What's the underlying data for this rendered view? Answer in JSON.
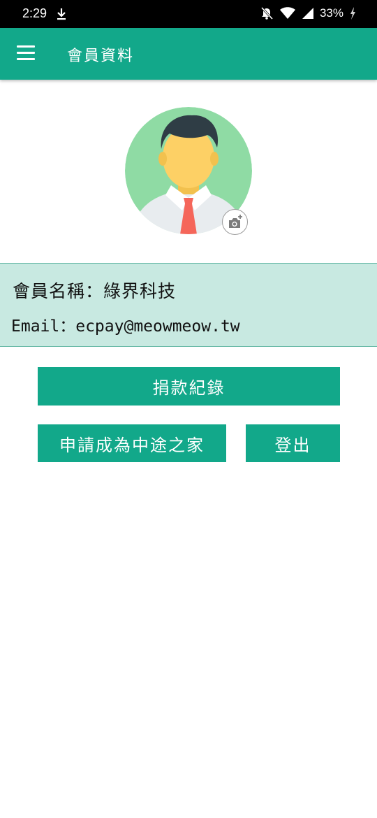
{
  "status_bar": {
    "time": "2:29",
    "battery": "33%"
  },
  "app_bar": {
    "title": "會員資料"
  },
  "profile": {
    "name_line": "會員名稱：綠界科技",
    "email_line": "Email：ecpay@meowmeow.tw"
  },
  "buttons": {
    "donation_records": "捐款紀錄",
    "apply_foster": "申請成為中途之家",
    "logout": "登出"
  },
  "colors": {
    "primary": "#12a88a",
    "info_bg": "#c8e9e1",
    "avatar_bg": "#8fdba4"
  },
  "icons": [
    "download-icon",
    "bell-off-icon",
    "wifi-icon",
    "signal-icon",
    "battery-charging-icon",
    "menu-icon",
    "camera-add-icon"
  ]
}
